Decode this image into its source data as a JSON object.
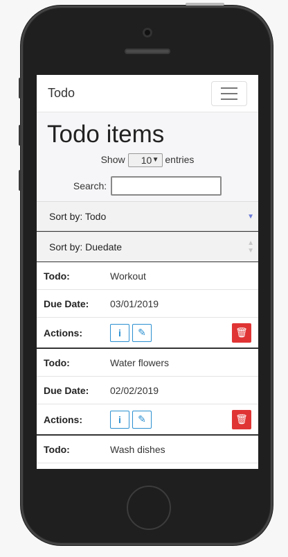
{
  "app": {
    "brand": "Todo",
    "title": "Todo items"
  },
  "table_controls": {
    "show_prefix": "Show",
    "page_size": "10",
    "show_suffix": "entries",
    "search_label": "Search:",
    "search_value": ""
  },
  "sort": {
    "todo": "Sort by: Todo",
    "duedate": "Sort by: Duedate"
  },
  "labels": {
    "todo": "Todo:",
    "due": "Due Date:",
    "actions": "Actions:"
  },
  "items": [
    {
      "todo": "Workout",
      "due": "03/01/2019"
    },
    {
      "todo": "Water flowers",
      "due": "02/02/2019"
    },
    {
      "todo": "Wash dishes"
    }
  ],
  "icons": {
    "info": "info-icon",
    "edit": "pencil-icon",
    "delete": "trash-icon",
    "sort_active": "sort-desc-icon",
    "sort_inactive": "sort-icon",
    "menu": "hamburger-icon"
  },
  "colors": {
    "accent": "#2a8fd0",
    "danger": "#e03434"
  }
}
